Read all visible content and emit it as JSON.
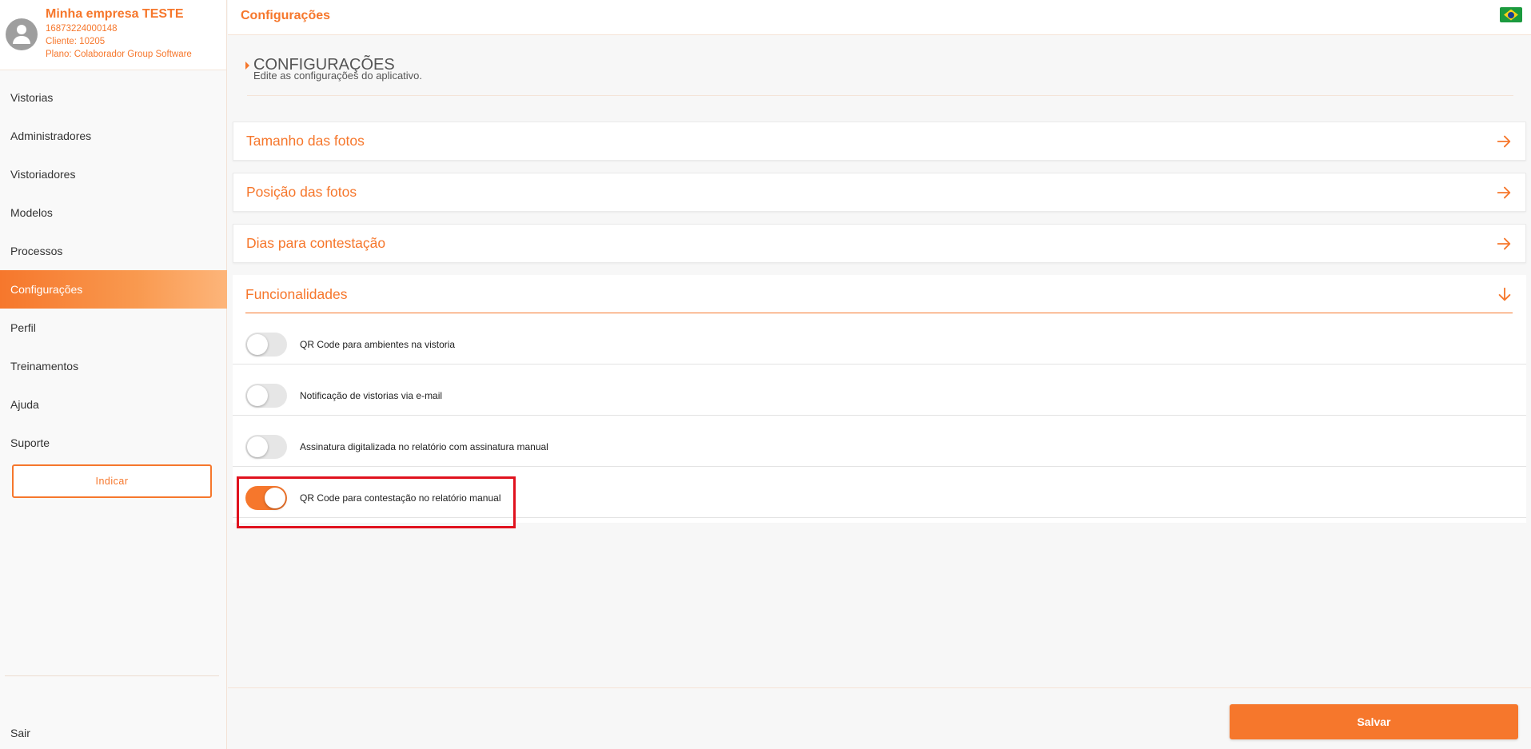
{
  "company": {
    "name": "Minha empresa TESTE",
    "document": "16873224000148",
    "client": "Cliente: 10205",
    "plan": "Plano: Colaborador Group Software"
  },
  "nav": {
    "items": [
      {
        "label": "Vistorias"
      },
      {
        "label": "Administradores"
      },
      {
        "label": "Vistoriadores"
      },
      {
        "label": "Modelos"
      },
      {
        "label": "Processos"
      },
      {
        "label": "Configurações"
      },
      {
        "label": "Perfil"
      },
      {
        "label": "Treinamentos"
      },
      {
        "label": "Ajuda"
      },
      {
        "label": "Suporte"
      }
    ],
    "active": "Configurações",
    "indicar_label": "Indicar",
    "sair_label": "Sair"
  },
  "header": {
    "title": "Configurações",
    "flag_icon": "brazil-flag-icon"
  },
  "section": {
    "title": "CONFIGURAÇÕES",
    "subtitle": "Edite as configurações do aplicativo."
  },
  "cards": [
    {
      "label": "Tamanho das fotos",
      "icon": "arrow-right-icon"
    },
    {
      "label": "Posição das fotos",
      "icon": "arrow-right-icon"
    },
    {
      "label": "Dias para contestação",
      "icon": "arrow-right-icon"
    }
  ],
  "features": {
    "title": "Funcionalidades",
    "icon": "arrow-down-icon",
    "toggles": [
      {
        "label": "QR Code para ambientes na vistoria",
        "enabled": false
      },
      {
        "label": "Notificação de vistorias via e-mail",
        "enabled": false
      },
      {
        "label": "Assinatura digitalizada no relatório com assinatura manual",
        "enabled": false
      },
      {
        "label": "QR Code para contestação no relatório manual",
        "enabled": true
      }
    ]
  },
  "footer": {
    "save_label": "Salvar"
  },
  "colors": {
    "accent": "#f6772c",
    "highlight": "#e0121e"
  }
}
